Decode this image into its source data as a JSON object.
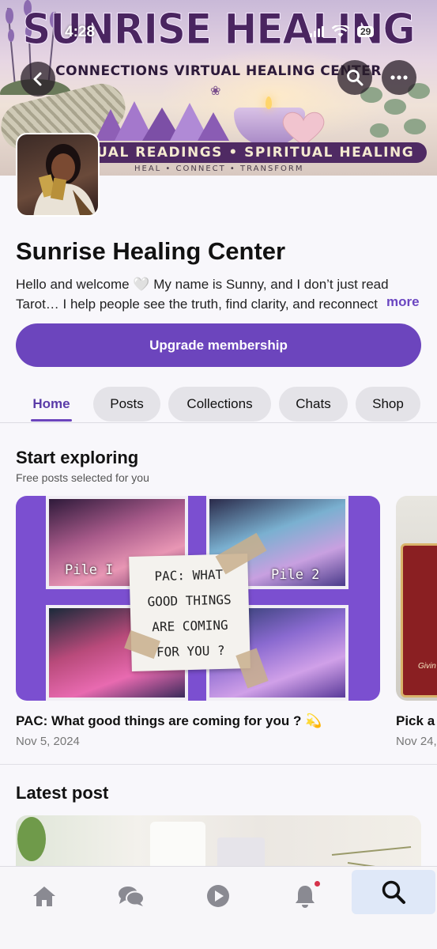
{
  "status": {
    "time": "4:28",
    "battery": "29"
  },
  "banner": {
    "title": "SUNRISE HEALING",
    "subtitle": "CONNECTIONS VIRTUAL HEALING CENTER",
    "ribbon": "UAL READINGS • SPIRITUAL HEALING",
    "tagline": "HEAL • CONNECT • TRANSFORM"
  },
  "header_icons": [
    "back-icon",
    "search-icon",
    "more-icon"
  ],
  "profile": {
    "name": "Sunrise Healing Center",
    "desc_line1": "Hello and welcome 🤍 My name is Sunny, and I don’t just read",
    "desc_line2": "Tarot… I help people see the truth, find clarity, and reconnect",
    "more_label": "more"
  },
  "upgrade_label": "Upgrade membership",
  "tabs": [
    {
      "label": "Home",
      "active": true
    },
    {
      "label": "Posts"
    },
    {
      "label": "Collections"
    },
    {
      "label": "Chats"
    },
    {
      "label": "Shop"
    }
  ],
  "explore": {
    "title": "Start exploring",
    "subtitle": "Free posts selected for you",
    "cards": [
      {
        "title": "PAC: What good things are coming for you ? 💫",
        "date": "Nov 5, 2024",
        "pile1": "Pile I",
        "pile2": "Pile 2",
        "note": [
          "PAC: WHAT",
          "GOOD THINGS",
          "ARE COMING",
          "FOR YOU ?"
        ]
      },
      {
        "title": "Pick a",
        "date": "Nov 24,",
        "card_text": "Givin"
      }
    ]
  },
  "latest": {
    "title": "Latest post"
  },
  "bottom_nav": [
    {
      "icon": "home-icon"
    },
    {
      "icon": "chat-bubbles-icon"
    },
    {
      "icon": "play-icon"
    },
    {
      "icon": "bell-icon",
      "has_dot": true
    },
    {
      "icon": "search-icon",
      "active": true
    }
  ],
  "colors": {
    "accent": "#6c45bd",
    "banner_title": "#4a2560",
    "notification": "#d6334b"
  }
}
